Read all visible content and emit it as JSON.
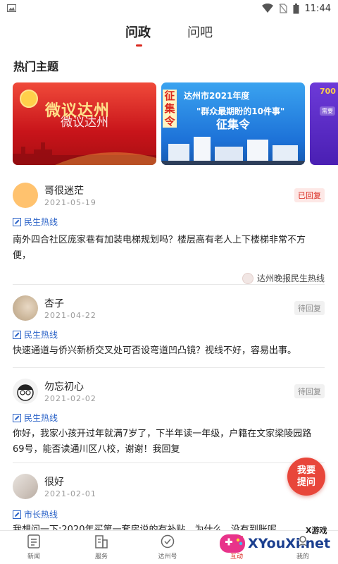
{
  "status_bar": {
    "time": "11:44"
  },
  "tabs": {
    "active": "问政",
    "inactive": "问吧"
  },
  "section_title": "热门主题",
  "banners": [
    {
      "title": "微议达州",
      "subtitle": "微议达州"
    },
    {
      "side_text": "征集令",
      "line1": "达州市2021年度",
      "line2": "\"群众最期盼的10件事\"",
      "line3": "征集令"
    },
    {
      "number": "700",
      "tag": "需要"
    }
  ],
  "posts": [
    {
      "name": "哥很迷茫",
      "date": "2021-05-19",
      "status": "已回复",
      "channel": "民生热线",
      "body": "南外四合社区庞家巷有加装电梯规划吗？楼层高有老人上下楼梯非常不方便，",
      "source": "达州晚报民生热线"
    },
    {
      "name": "杏子",
      "date": "2021-04-22",
      "status": "待回复",
      "channel": "民生热线",
      "body": "快速通道与侨兴新桥交叉处可否设弯道凹凸镜？视线不好，容易出事。"
    },
    {
      "name": "勿忘初心",
      "date": "2021-02-02",
      "status": "待回复",
      "channel": "民生热线",
      "body": "你好，我家小孩开过年就满7岁了，下半年读一年级，户籍在文家梁陵园路69号，能否读通川区八校，谢谢！我回复"
    },
    {
      "name": "很好",
      "date": "2021-02-01",
      "channel": "市长热线",
      "body": "我想问一下:2020年买第一套房说的有补贴，为什么...没有到账呢"
    }
  ],
  "ask_button": {
    "line1": "我要",
    "line2": "提问"
  },
  "bottom_nav": [
    "新闻",
    "服务",
    "达州号",
    "互动",
    "我的"
  ],
  "watermark": {
    "small": "X游戏",
    "big": "XYouXi.net"
  },
  "colors": {
    "accent": "#d9281e",
    "link": "#2b63c8"
  }
}
